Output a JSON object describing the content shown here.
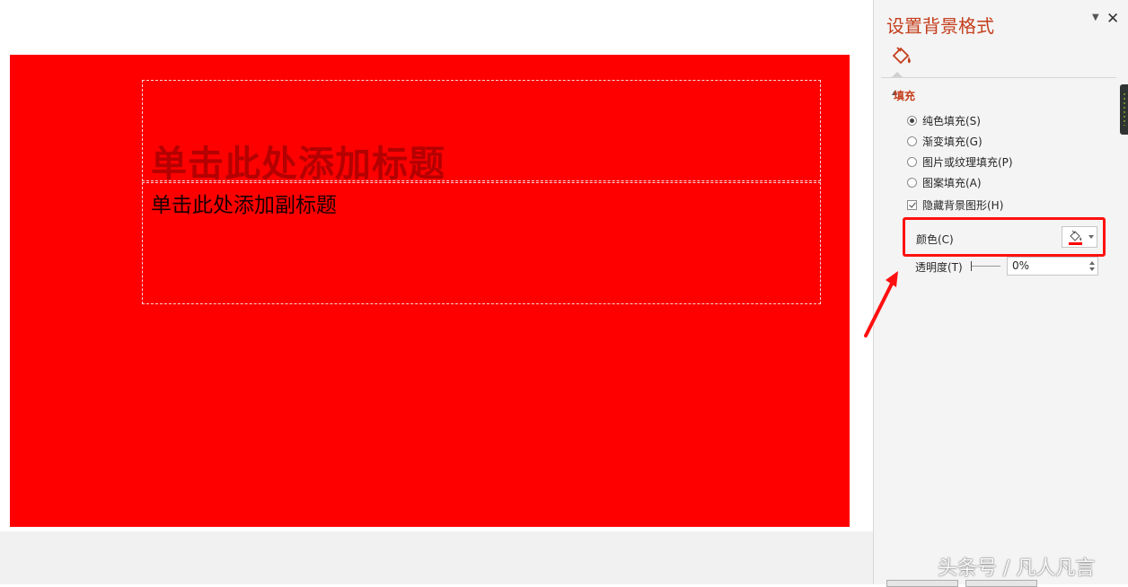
{
  "slide": {
    "title_placeholder": "单击此处添加标题",
    "subtitle_placeholder": "单击此处添加副标题",
    "background_color": "#ff0000"
  },
  "pane": {
    "title": "设置背景格式",
    "fill_tab_icon": "paint-bucket-icon",
    "section_title": "填充",
    "options": [
      {
        "label": "纯色填充(S)",
        "type": "radio",
        "checked": true
      },
      {
        "label": "渐变填充(G)",
        "type": "radio",
        "checked": false
      },
      {
        "label": "图片或纹理填充(P)",
        "type": "radio",
        "checked": false
      },
      {
        "label": "图案填充(A)",
        "type": "radio",
        "checked": false
      },
      {
        "label": "隐藏背景图形(H)",
        "type": "checkbox",
        "checked": true
      }
    ],
    "color_label": "颜色(C)",
    "selected_color": "#ff0000",
    "transparency_label": "透明度(T)",
    "transparency_value": "0%"
  },
  "annotation": {
    "highlight_color": "#ff1010"
  },
  "watermark": "头条号 / 凡人凡言"
}
